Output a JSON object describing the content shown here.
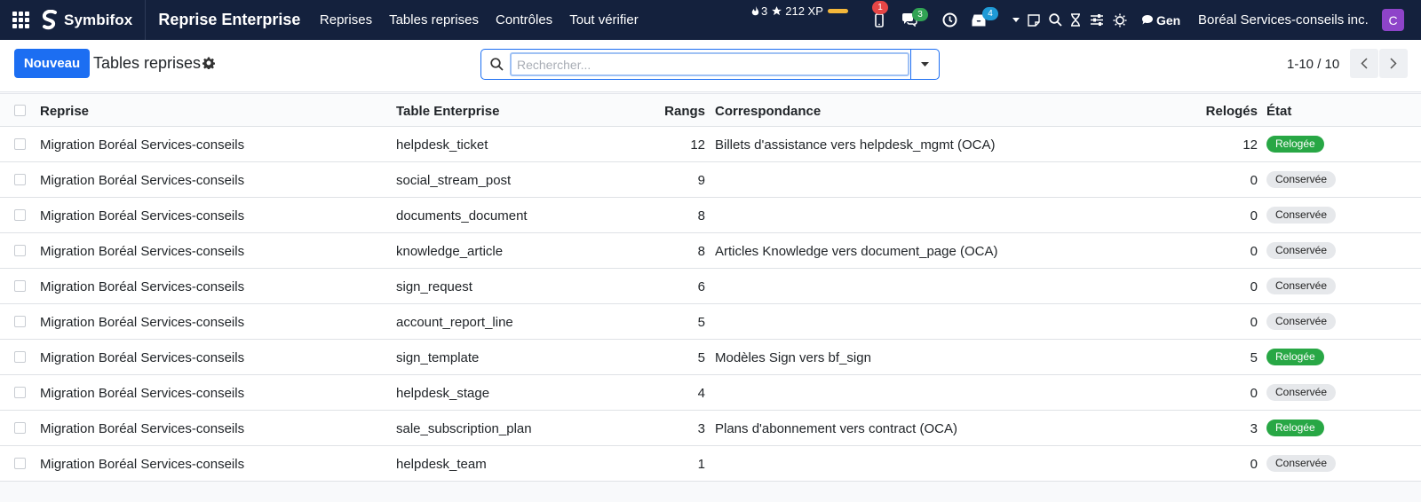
{
  "navbar": {
    "brand": "Symbifox",
    "app_title": "Reprise Enterprise",
    "menu": [
      "Reprises",
      "Tables reprises",
      "Contrôles",
      "Tout vérifier"
    ],
    "xp_level": "3",
    "xp_points": "212 XP",
    "phone_badge": "1",
    "chat_badge": "3",
    "inbox_badge": "4",
    "gen_label": "Gen",
    "company": "Boréal Services-conseils inc.",
    "avatar_letter": "C"
  },
  "control": {
    "new_button": "Nouveau",
    "title": "Tables reprises",
    "search_placeholder": "Rechercher...",
    "pager": "1-10 / 10"
  },
  "table": {
    "headers": {
      "reprise": "Reprise",
      "table": "Table Enterprise",
      "rangs": "Rangs",
      "correspondance": "Correspondance",
      "reloges": "Relogés",
      "etat": "État"
    },
    "rows": [
      {
        "reprise": "Migration Boréal Services-conseils",
        "table": "helpdesk_ticket",
        "rangs": "12",
        "correspondance": "Billets d'assistance vers helpdesk_mgmt (OCA)",
        "reloges": "12",
        "etat": "Relogée",
        "status": "green"
      },
      {
        "reprise": "Migration Boréal Services-conseils",
        "table": "social_stream_post",
        "rangs": "9",
        "correspondance": "",
        "reloges": "0",
        "etat": "Conservée",
        "status": "grey"
      },
      {
        "reprise": "Migration Boréal Services-conseils",
        "table": "documents_document",
        "rangs": "8",
        "correspondance": "",
        "reloges": "0",
        "etat": "Conservée",
        "status": "grey"
      },
      {
        "reprise": "Migration Boréal Services-conseils",
        "table": "knowledge_article",
        "rangs": "8",
        "correspondance": "Articles Knowledge vers document_page (OCA)",
        "reloges": "0",
        "etat": "Conservée",
        "status": "grey"
      },
      {
        "reprise": "Migration Boréal Services-conseils",
        "table": "sign_request",
        "rangs": "6",
        "correspondance": "",
        "reloges": "0",
        "etat": "Conservée",
        "status": "grey"
      },
      {
        "reprise": "Migration Boréal Services-conseils",
        "table": "account_report_line",
        "rangs": "5",
        "correspondance": "",
        "reloges": "0",
        "etat": "Conservée",
        "status": "grey"
      },
      {
        "reprise": "Migration Boréal Services-conseils",
        "table": "sign_template",
        "rangs": "5",
        "correspondance": "Modèles Sign vers bf_sign",
        "reloges": "5",
        "etat": "Relogée",
        "status": "green"
      },
      {
        "reprise": "Migration Boréal Services-conseils",
        "table": "helpdesk_stage",
        "rangs": "4",
        "correspondance": "",
        "reloges": "0",
        "etat": "Conservée",
        "status": "grey"
      },
      {
        "reprise": "Migration Boréal Services-conseils",
        "table": "sale_subscription_plan",
        "rangs": "3",
        "correspondance": "Plans d'abonnement vers contract (OCA)",
        "reloges": "3",
        "etat": "Relogée",
        "status": "green"
      },
      {
        "reprise": "Migration Boréal Services-conseils",
        "table": "helpdesk_team",
        "rangs": "1",
        "correspondance": "",
        "reloges": "0",
        "etat": "Conservée",
        "status": "grey"
      }
    ]
  },
  "colors": {
    "navbar_bg": "#14213d",
    "primary": "#1c6ef2",
    "status_green": "#28a745",
    "status_grey": "#e6e8eb"
  }
}
